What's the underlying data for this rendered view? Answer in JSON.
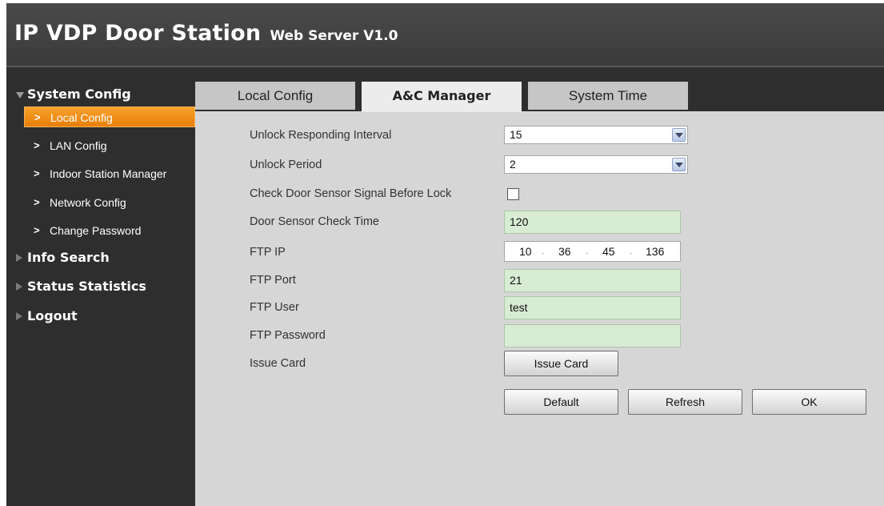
{
  "header": {
    "title": "IP VDP Door Station",
    "subtitle": "Web Server V1.0"
  },
  "sidebar": {
    "system_config": {
      "label": "System Config",
      "items": [
        {
          "label": "Local Config"
        },
        {
          "label": "LAN Config"
        },
        {
          "label": "Indoor Station Manager"
        },
        {
          "label": "Network Config"
        },
        {
          "label": "Change Password"
        }
      ]
    },
    "info_search": "Info Search",
    "status_statistics": "Status Statistics",
    "logout": "Logout"
  },
  "tabs": [
    {
      "label": "Local Config"
    },
    {
      "label": "A&C Manager"
    },
    {
      "label": "System Time"
    }
  ],
  "form": {
    "unlock_interval": {
      "label": "Unlock Responding Interval",
      "value": "15"
    },
    "unlock_period": {
      "label": "Unlock Period",
      "value": "2"
    },
    "check_door_sensor": {
      "label": "Check Door Sensor Signal Before Lock",
      "checked": false
    },
    "door_sensor_time": {
      "label": "Door Sensor Check Time",
      "value": "120"
    },
    "ftp_ip": {
      "label": "FTP IP",
      "octets": [
        "10",
        "36",
        "45",
        "136"
      ]
    },
    "ftp_port": {
      "label": "FTP Port",
      "value": "21"
    },
    "ftp_user": {
      "label": "FTP User",
      "value": "test"
    },
    "ftp_password": {
      "label": "FTP Password",
      "value": ""
    },
    "issue_card": {
      "label": "Issue Card",
      "button": "Issue Card"
    }
  },
  "buttons": {
    "default": "Default",
    "refresh": "Refresh",
    "ok": "OK"
  },
  "colors": {
    "active_nav": "#f39419",
    "input_green": "#d8ecd4",
    "panel_bg": "#d6d6d6",
    "sidebar_bg": "#2e2e2e"
  }
}
